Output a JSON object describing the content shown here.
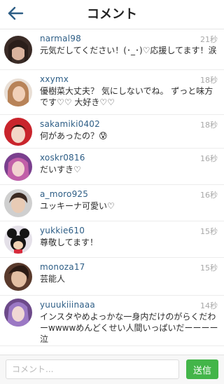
{
  "header": {
    "title": "コメント",
    "back_icon": "arrow-left-icon"
  },
  "comments": [
    {
      "username": "narmal98",
      "time": "21秒",
      "text": "元気だしてください！(･_･)♡応援してます！涙"
    },
    {
      "username": "xxymx",
      "time": "18秒",
      "text": "優樹菜大丈夫？ 気にしないでね。 ずっと味方です♡♡ 大好き♡♡"
    },
    {
      "username": "sakamiki0402",
      "time": "18秒",
      "text": "何があったの？😰"
    },
    {
      "username": "xoskr0816",
      "time": "16秒",
      "text": "だいすき♡"
    },
    {
      "username": "a_moro925",
      "time": "16秒",
      "text": "ユッキーナ可愛い♡"
    },
    {
      "username": "yukkie610",
      "time": "15秒",
      "text": "尊敬してます！"
    },
    {
      "username": "monoza17",
      "time": "15秒",
      "text": "芸能人"
    },
    {
      "username": "yuuukiiinaaa",
      "time": "14秒",
      "text": "インスタやめよっかな一身内だけのがらくだわーwwwwめんどくせい人間いっぱいだーーーー泣"
    }
  ],
  "footer": {
    "input_placeholder": "コメント...",
    "input_value": "",
    "send_label": "送信"
  },
  "colors": {
    "username": "#2e5e86",
    "time": "#a8a8a8",
    "send_button": "#43b549",
    "back_arrow": "#2e5e86"
  }
}
